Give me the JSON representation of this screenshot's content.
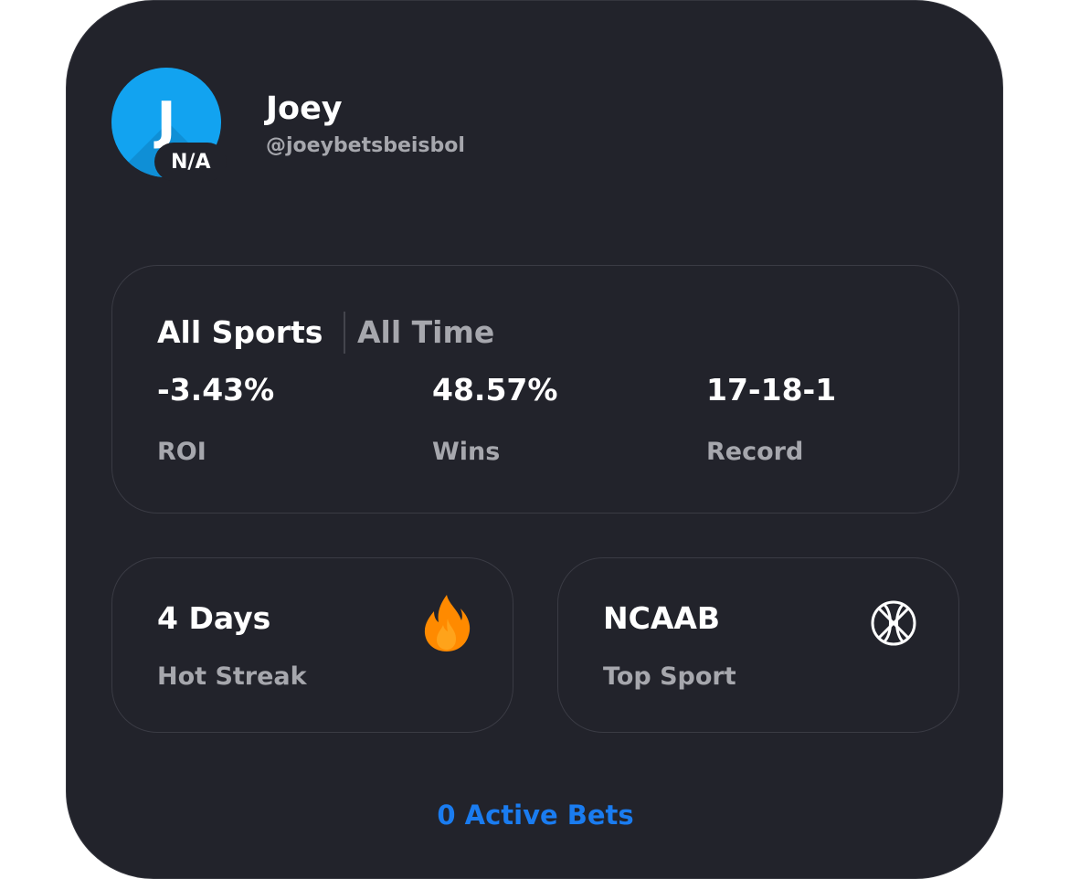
{
  "profile": {
    "avatar_initial": "J",
    "rank_badge": "N/A",
    "name": "Joey",
    "handle": "@joeybetsbeisbol"
  },
  "filters": {
    "sport": "All Sports",
    "time": "All Time"
  },
  "stats": [
    {
      "value": "-3.43%",
      "label": "ROI"
    },
    {
      "value": "48.57%",
      "label": "Wins"
    },
    {
      "value": "17-18-1",
      "label": "Record"
    }
  ],
  "streak": {
    "value": "4 Days",
    "label": "Hot Streak",
    "icon": "fire-icon"
  },
  "top_sport": {
    "value": "NCAAB",
    "label": "Top Sport",
    "icon": "basketball-icon"
  },
  "active_bets": {
    "label": "0 Active Bets"
  },
  "colors": {
    "card_background": "#22232b",
    "avatar": "#12a3f0",
    "accent": "#1a7cf0",
    "fire": "#ff8a00",
    "muted_text": "#a6a7ad"
  }
}
